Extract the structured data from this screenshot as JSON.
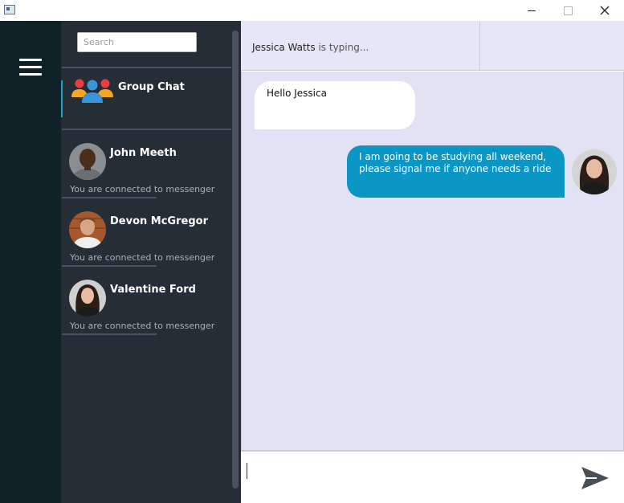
{
  "window": {
    "controls": [
      "minimize-icon",
      "maximize-icon",
      "close-icon"
    ]
  },
  "sidebar": {
    "menu_icon": "hamburger-menu-icon"
  },
  "contacts": {
    "search_placeholder": "Search",
    "group": {
      "label": "Group Chat",
      "icon": "group-people-icon"
    },
    "items": [
      {
        "name": "John Meeth",
        "status": "You are connected to messenger"
      },
      {
        "name": "Devon McGregor",
        "status": "You are connected to messenger"
      },
      {
        "name": "Valentine Ford",
        "status": "You are connected to messenger"
      }
    ]
  },
  "chat": {
    "header": {
      "typing_name": "Jessica Watts",
      "typing_suffix": "is typing..."
    },
    "messages": [
      {
        "direction": "incoming",
        "text": "Hello Jessica"
      },
      {
        "direction": "outgoing",
        "text": "I am going to be studying all weekend, please signal me if anyone needs a ride"
      }
    ],
    "composer": {
      "value": "",
      "send_icon": "send-icon"
    }
  },
  "colors": {
    "rail": "#102128",
    "contacts_bg": "#252d37",
    "chat_bg": "#e2e2f4",
    "outgoing_bubble": "#0a97c6",
    "incoming_bubble": "#ffffff",
    "accent": "#1a9fd0"
  }
}
